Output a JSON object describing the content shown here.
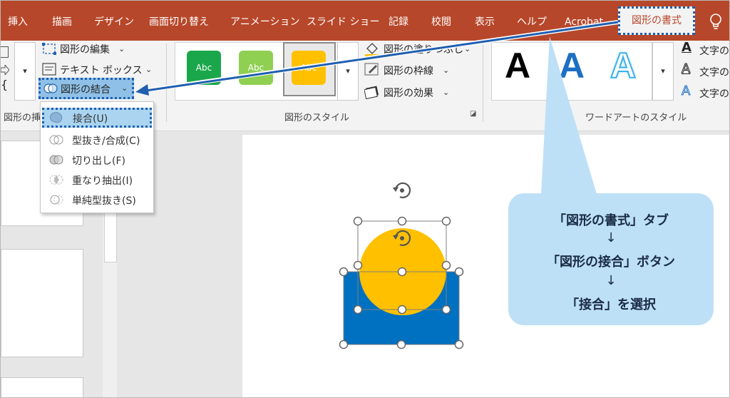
{
  "ribbon_tabs": [
    "挿入",
    "描画",
    "デザイン",
    "画面切り替え",
    "アニメーション",
    "スライド ショー",
    "記録",
    "校閲",
    "表示",
    "ヘルプ",
    "Acrobat",
    "図形の書式"
  ],
  "active_tab": "図形の書式",
  "insert_shapes": {
    "edit_shape": "図形の編集",
    "text_box": "テキスト ボックス",
    "merge_shapes": "図形の結合",
    "group_label": "図形の挿"
  },
  "shape_styles": {
    "swatch_text": "Abc",
    "swatch_colors": [
      "#1aa64a",
      "#8fcf52",
      "#ffc000"
    ],
    "fill": "図形の塗りつぶし",
    "outline": "図形の枠線",
    "effects": "図形の効果",
    "group_label": "図形のスタイル"
  },
  "wordart": {
    "sample_letter": "A",
    "text_fill": "文字の",
    "text_outline": "文字の",
    "text_effects": "文字の",
    "group_label": "ワードアートのスタイル"
  },
  "merge_menu": {
    "items": [
      {
        "label": "接合(U)",
        "mnemonic": "U",
        "highlighted": true
      },
      {
        "label": "型抜き/合成(C)",
        "mnemonic": "C",
        "highlighted": false
      },
      {
        "label": "切り出し(F)",
        "mnemonic": "F",
        "highlighted": false
      },
      {
        "label": "重なり抽出(I)",
        "mnemonic": "I",
        "highlighted": false
      },
      {
        "label": "単純型抜き(S)",
        "mnemonic": "S",
        "highlighted": false
      }
    ]
  },
  "slide_shapes": {
    "circle_color": "#ffc000",
    "rect_color": "#0070c0"
  },
  "callout": {
    "line1": "「図形の書式」タブ",
    "arrow": "↓",
    "line2": "「図形の接合」ボタン",
    "line3": "「接合」を選択",
    "bg_color": "#bde0f7"
  },
  "colors": {
    "ribbon_accent": "#b7472a",
    "annotation_blue": "#1f5fb0"
  }
}
